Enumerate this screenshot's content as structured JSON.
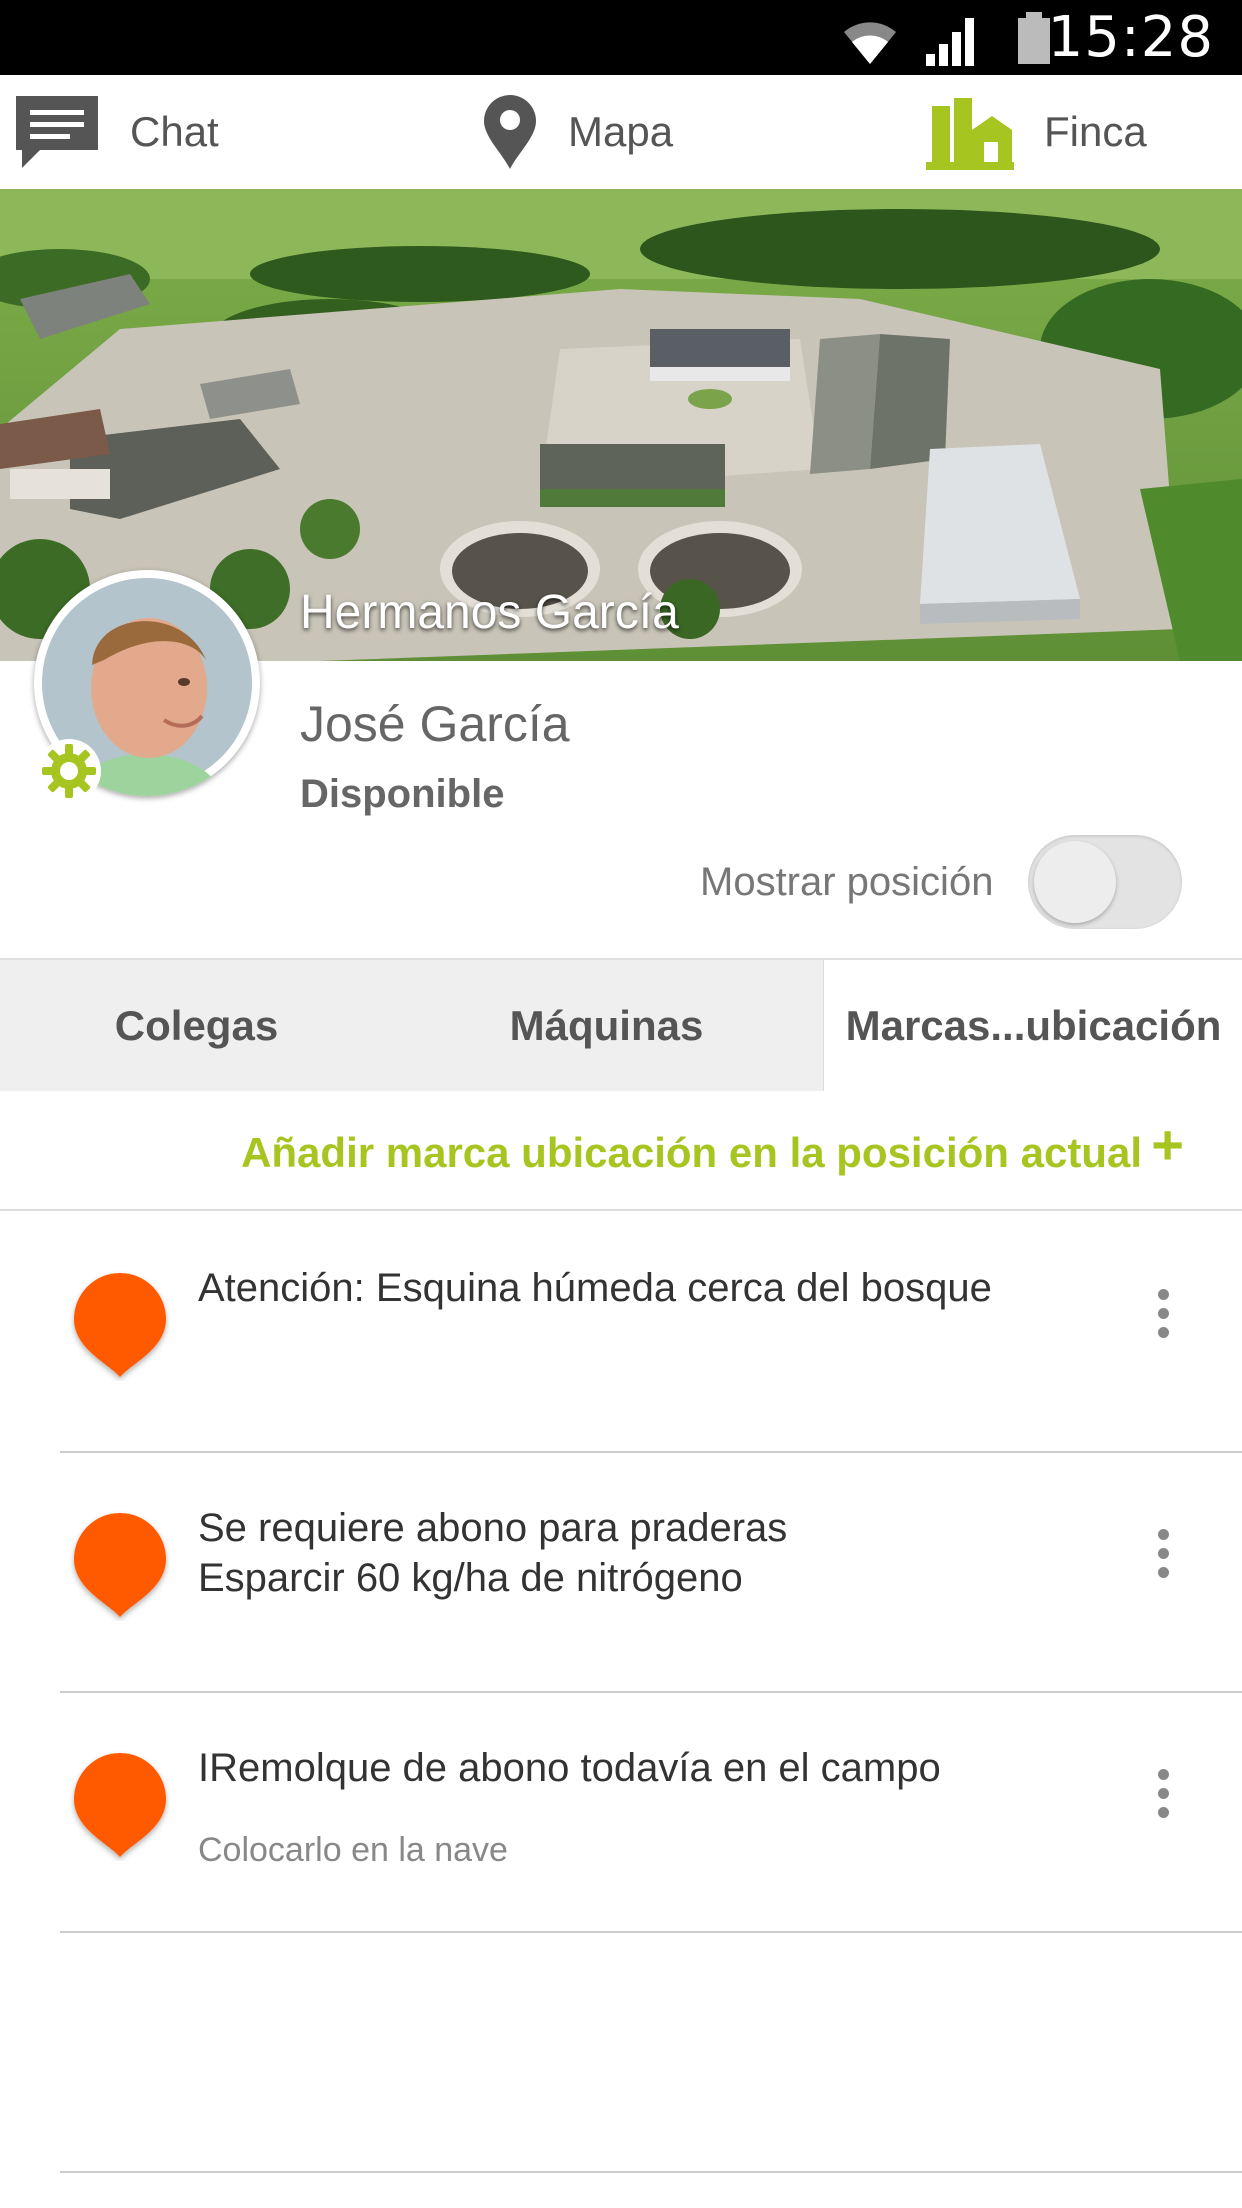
{
  "status_bar": {
    "time": "15:28",
    "icons": [
      "wifi-icon",
      "signal-icon",
      "battery-icon"
    ]
  },
  "nav": {
    "items": [
      {
        "label": "Chat",
        "icon": "chat-icon"
      },
      {
        "label": "Mapa",
        "icon": "map-pin-icon"
      },
      {
        "label": "Finca",
        "icon": "farm-icon",
        "active": true
      }
    ]
  },
  "profile": {
    "farm_name": "Hermanos García",
    "user_name": "José García",
    "status": "Disponible",
    "show_position_label": "Mostrar posición",
    "show_position": false
  },
  "tabs": [
    {
      "label": "Colegas"
    },
    {
      "label": "Máquinas"
    },
    {
      "label": "Marcas...ubicación",
      "active": true
    }
  ],
  "add_marker": {
    "label": "Añadir marca ubicación en la posición actual",
    "icon": "+"
  },
  "markers": [
    {
      "title_lines": [
        "Atención: Esquina húmeda cerca del bosque"
      ],
      "subtitle": ""
    },
    {
      "title_lines": [
        "Se requiere abono para praderas",
        "Esparcir 60 kg/ha de nitrógeno"
      ],
      "subtitle": ""
    },
    {
      "title_lines": [
        "IRemolque de abono todavía en el campo"
      ],
      "subtitle": "Colocarlo en la nave"
    }
  ],
  "colors": {
    "accent": "#a7c520",
    "marker": "#ff5a00",
    "status_bar": "#000000"
  }
}
